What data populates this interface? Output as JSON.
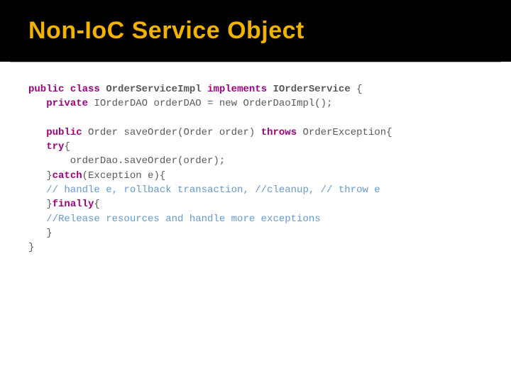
{
  "title": "Non-IoC Service Object",
  "code": {
    "kw_public1": "public",
    "kw_class": "class",
    "class_name": "OrderServiceImpl",
    "kw_implements": "implements",
    "iface": "IOrderService",
    "brace_open1": " {",
    "kw_private": "private",
    "line2_rest": " IOrderDAO orderDAO = new OrderDaoImpl();",
    "kw_public2": "public",
    "line4_rest": " Order saveOrder(Order order) ",
    "kw_throws": "throws",
    "line4_tail": " OrderException{",
    "kw_try": "try",
    "brace_open2": "{",
    "line6": "       orderDao.saveOrder(order);",
    "close_catch_pre": "   }",
    "kw_catch": "catch",
    "catch_rest": "(Exception e){",
    "comment1": "   // handle e, rollback transaction, //cleanup, // throw e",
    "close_fin_pre": "   }",
    "kw_finally": "finally",
    "fin_rest": "{",
    "comment2": "   //Release resources and handle more exceptions",
    "close_inner": "   }",
    "close_outer": "}"
  }
}
